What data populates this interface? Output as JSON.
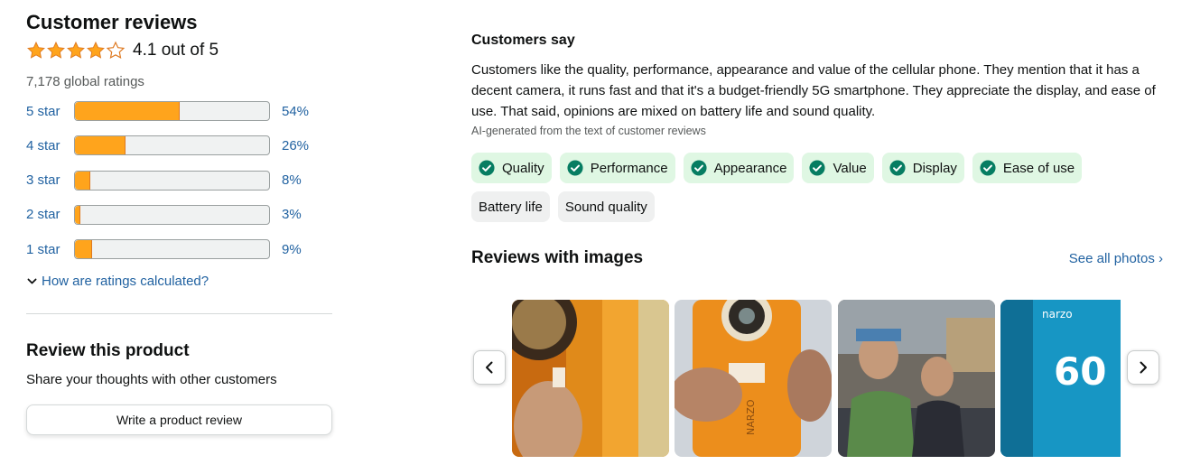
{
  "reviews": {
    "title": "Customer reviews",
    "rating_value": 4.1,
    "rating_text": "4.1 out of 5",
    "global_ratings": "7,178 global ratings",
    "histogram": [
      {
        "label": "5 star",
        "pct_text": "54%",
        "percent": 54
      },
      {
        "label": "4 star",
        "pct_text": "26%",
        "percent": 26
      },
      {
        "label": "3 star",
        "pct_text": "8%",
        "percent": 8
      },
      {
        "label": "2 star",
        "pct_text": "3%",
        "percent": 3
      },
      {
        "label": "1 star",
        "pct_text": "9%",
        "percent": 9
      }
    ],
    "how_calculated": "How are ratings calculated?"
  },
  "review_product": {
    "title": "Review this product",
    "subtitle": "Share your thoughts with other customers",
    "button": "Write a product review"
  },
  "customers_say": {
    "title": "Customers say",
    "summary": "Customers like the quality, performance, appearance and value of the cellular phone. They mention that it has a decent camera, it runs fast and that it's a budget-friendly 5G smartphone. They appreciate the display, and ease of use. That said, opinions are mixed on battery life and sound quality.",
    "ai_note": "AI-generated from the text of customer reviews",
    "positive_tags": [
      "Quality",
      "Performance",
      "Appearance",
      "Value",
      "Display",
      "Ease of use"
    ],
    "mixed_tags": [
      "Battery life",
      "Sound quality"
    ]
  },
  "images_section": {
    "title": "Reviews with images",
    "see_all": "See all photos",
    "thumbnails": [
      {
        "icon": "phone-back-photo"
      },
      {
        "icon": "phone-camera-photo",
        "text": "NARZO"
      },
      {
        "icon": "people-selfie-photo"
      },
      {
        "icon": "phone-box-photo",
        "text": "60",
        "brand": "narzo"
      }
    ]
  },
  "colors": {
    "accent_orange": "#ffa41c",
    "link_blue": "#2162a1",
    "positive_tag_bg": "#dff7e3",
    "check_green": "#067d62",
    "neutral_tag_bg": "#eff0f0"
  }
}
